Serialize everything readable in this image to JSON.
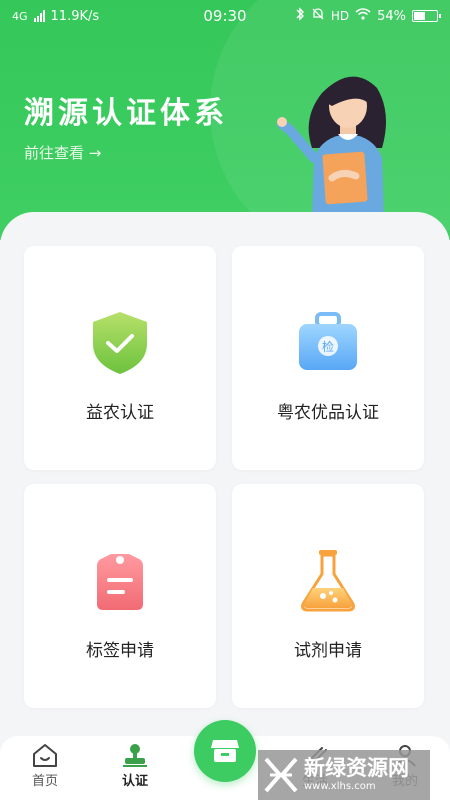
{
  "status_bar": {
    "network": "4G",
    "speed": "11.9K/s",
    "time": "09:30",
    "hd": "HD",
    "battery": "54%",
    "battery_level": 0.54
  },
  "hero": {
    "title": "溯源认证体系",
    "link": "前往查看 →"
  },
  "cards": [
    {
      "label": "益农认证",
      "icon": "shield-check-icon"
    },
    {
      "label": "粤农优品认证",
      "icon": "inspection-case-icon"
    },
    {
      "label": "标签申请",
      "icon": "tag-icon"
    },
    {
      "label": "试剂申请",
      "icon": "flask-icon"
    }
  ],
  "case_glyph": "检",
  "tabs": [
    {
      "label": "首页",
      "icon": "home-icon"
    },
    {
      "label": "认证",
      "icon": "stamp-icon",
      "active": true
    },
    {
      "label": "生活",
      "icon": "life-icon"
    },
    {
      "label": "我的",
      "icon": "user-icon"
    }
  ],
  "watermark": {
    "text": "新绿资源网",
    "sub": "www.xlhs.com"
  },
  "colors": {
    "brand": "#3ccc61"
  }
}
